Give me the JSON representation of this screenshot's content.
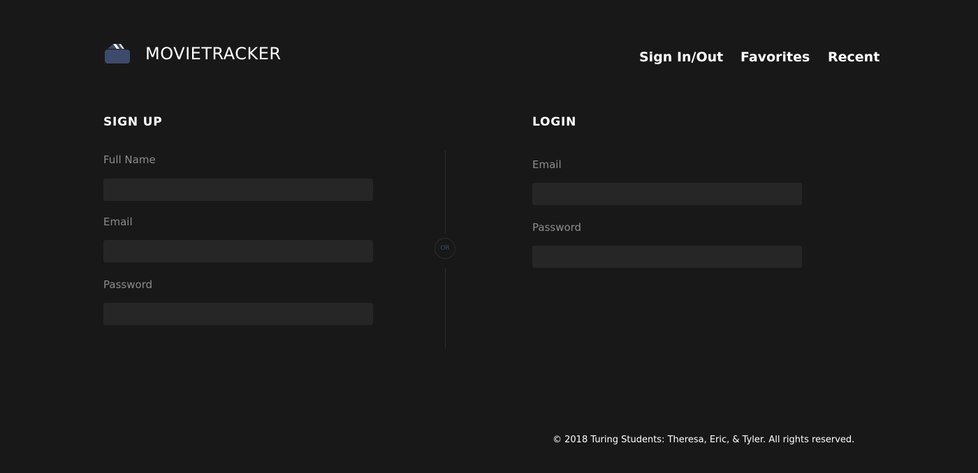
{
  "header": {
    "brand": "MOVIETRACKER",
    "logo_icon": "movie-clapper-icon",
    "logo_color": "#3d4a6b",
    "nav": {
      "sign_in_out": "Sign In/Out",
      "favorites": "Favorites",
      "recent": "Recent"
    }
  },
  "signup": {
    "title": "SIGN UP",
    "full_name_label": "Full Name",
    "email_label": "Email",
    "password_label": "Password",
    "full_name_value": "",
    "email_value": "",
    "password_value": ""
  },
  "divider": {
    "label": "OR"
  },
  "login": {
    "title": "LOGIN",
    "email_label": "Email",
    "password_label": "Password",
    "email_value": "",
    "password_value": ""
  },
  "footer": {
    "copyright": "© 2018 Turing Students: Theresa, Eric, & Tyler. All rights reserved."
  },
  "colors": {
    "background": "#181818",
    "input_background": "#262626",
    "label": "#8c8c8c",
    "accent": "#3d4a6b"
  }
}
